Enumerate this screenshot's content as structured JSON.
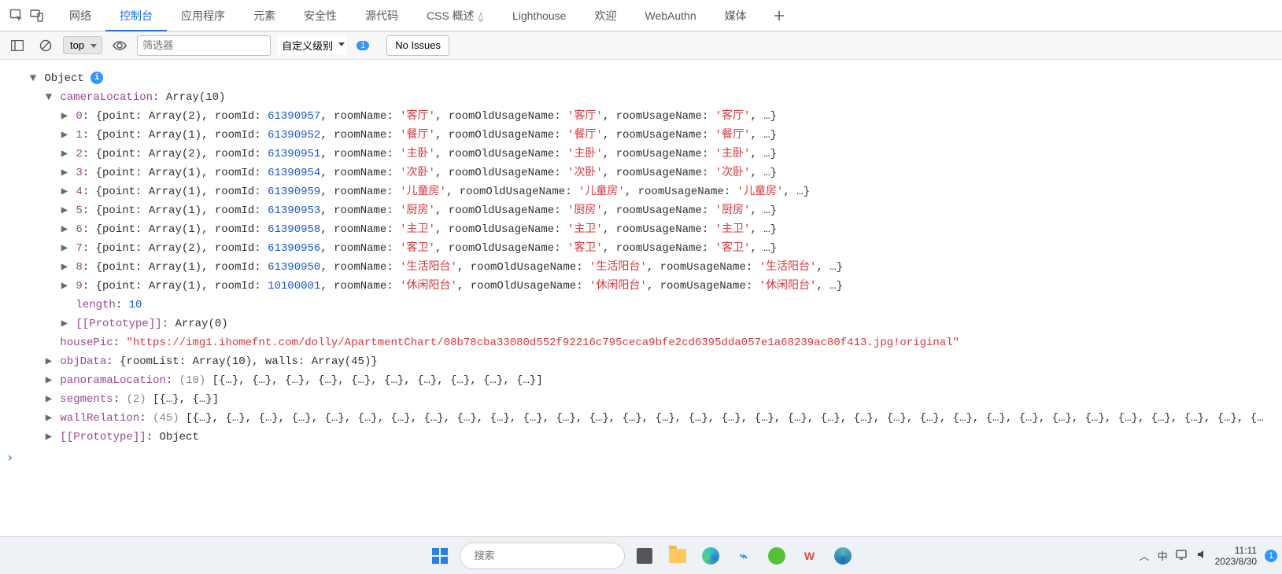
{
  "tabs": [
    "网络",
    "控制台",
    "应用程序",
    "元素",
    "安全性",
    "源代码",
    "CSS 概述 ⍙",
    "Lighthouse",
    "欢迎",
    "WebAuthn",
    "媒体"
  ],
  "activeTab": "控制台",
  "toolbar": {
    "context": "top",
    "filterPlaceholder": "筛选器",
    "level": "自定义级别",
    "levelBadge": "1",
    "noIssues": "No Issues"
  },
  "objectLabel": "Object",
  "cameraLocation": {
    "key": "cameraLocation",
    "typeLabel": "Array(10)",
    "items": [
      {
        "idx": "0",
        "pointLen": "2",
        "roomId": "61390957",
        "roomName": "客厅",
        "roomOldUsageName": "客厅",
        "roomUsageName": "客厅"
      },
      {
        "idx": "1",
        "pointLen": "1",
        "roomId": "61390952",
        "roomName": "餐厅",
        "roomOldUsageName": "餐厅",
        "roomUsageName": "餐厅"
      },
      {
        "idx": "2",
        "pointLen": "2",
        "roomId": "61390951",
        "roomName": "主卧",
        "roomOldUsageName": "主卧",
        "roomUsageName": "主卧"
      },
      {
        "idx": "3",
        "pointLen": "1",
        "roomId": "61390954",
        "roomName": "次卧",
        "roomOldUsageName": "次卧",
        "roomUsageName": "次卧"
      },
      {
        "idx": "4",
        "pointLen": "1",
        "roomId": "61390959",
        "roomName": "儿童房",
        "roomOldUsageName": "儿童房",
        "roomUsageName": "儿童房"
      },
      {
        "idx": "5",
        "pointLen": "1",
        "roomId": "61390953",
        "roomName": "厨房",
        "roomOldUsageName": "厨房",
        "roomUsageName": "厨房"
      },
      {
        "idx": "6",
        "pointLen": "1",
        "roomId": "61390958",
        "roomName": "主卫",
        "roomOldUsageName": "主卫",
        "roomUsageName": "主卫"
      },
      {
        "idx": "7",
        "pointLen": "2",
        "roomId": "61390956",
        "roomName": "客卫",
        "roomOldUsageName": "客卫",
        "roomUsageName": "客卫"
      },
      {
        "idx": "8",
        "pointLen": "1",
        "roomId": "61390950",
        "roomName": "生活阳台",
        "roomOldUsageName": "生活阳台",
        "roomUsageName": "生活阳台"
      },
      {
        "idx": "9",
        "pointLen": "1",
        "roomId": "10100001",
        "roomName": "休闲阳台",
        "roomOldUsageName": "休闲阳台",
        "roomUsageName": "休闲阳台"
      }
    ],
    "lengthKey": "length",
    "lengthVal": "10",
    "protoKey": "[[Prototype]]",
    "protoVal": "Array(0)"
  },
  "housePic": {
    "key": "housePic",
    "value": "\"https://img1.ihomefnt.com/dolly/ApartmentChart/08b78cba33080d552f92216c795ceca9bfe2cd6395dda057e1a68239ac80f413.jpg!original\""
  },
  "objData": {
    "key": "objData",
    "roomListLabel": "roomList",
    "roomListVal": "Array(10)",
    "wallsLabel": "walls",
    "wallsVal": "Array(45)"
  },
  "panoramaLocation": {
    "key": "panoramaLocation",
    "count": "(10)",
    "preview": "[{…}, {…}, {…}, {…}, {…}, {…}, {…}, {…}, {…}, {…}]"
  },
  "segments": {
    "key": "segments",
    "count": "(2)",
    "preview": "[{…}, {…}]"
  },
  "wallRelation": {
    "key": "wallRelation",
    "count": "(45)",
    "preview": "[{…}, {…}, {…}, {…}, {…}, {…}, {…}, {…}, {…}, {…}, {…}, {…}, {…}, {…}, {…}, {…}, {…}, {…}, {…}, {…}, {…}, {…}, {…}, {…}, {…}, {…}, {…}, {…}, {…}, {…}, {…}, {…}, {…"
  },
  "protoObj": {
    "key": "[[Prototype]]",
    "val": "Object"
  },
  "labels": {
    "point": "point",
    "roomId": "roomId",
    "roomName": "roomName",
    "roomOldUsageName": "roomOldUsageName",
    "roomUsageName": "roomUsageName",
    "arrayPrefix": "Array("
  },
  "taskbar": {
    "searchPlaceholder": "搜索",
    "ime": "中",
    "time": "11:11",
    "date": "2023/8/30",
    "notif": "1"
  }
}
